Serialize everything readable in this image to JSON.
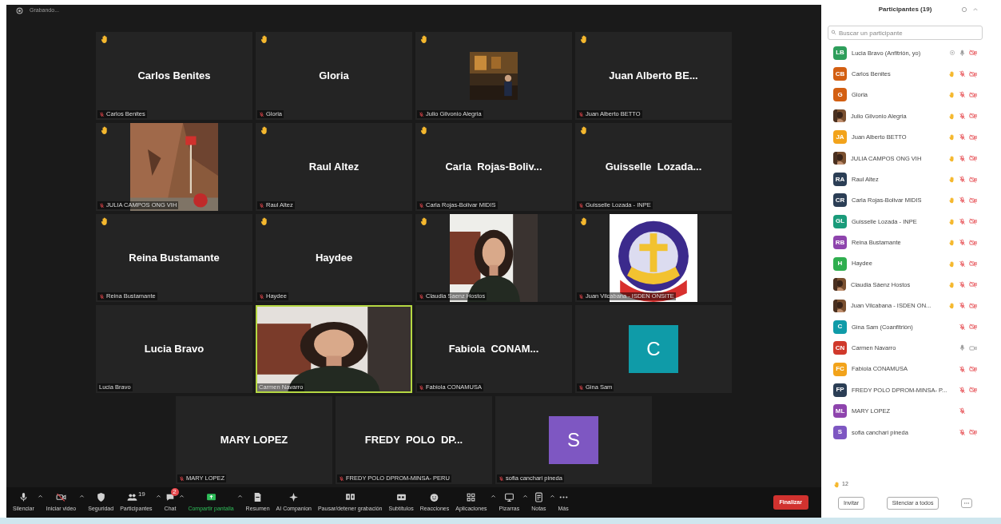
{
  "top_bar": {
    "status": "Grabando..."
  },
  "tiles": [
    {
      "kind": "name",
      "display": "Carlos Benites",
      "label": "Carlos Benites",
      "hand": true,
      "muted": true,
      "speaking": false
    },
    {
      "kind": "name",
      "display": "Gloria",
      "label": "Gloria",
      "hand": true,
      "muted": true,
      "speaking": false
    },
    {
      "kind": "picture",
      "label": "Julio Gilvonio Alegria",
      "hand": true,
      "muted": true,
      "speaking": false
    },
    {
      "kind": "name",
      "display": "Juan Alberto BE...",
      "label": "Juan Alberto BETTO",
      "hand": true,
      "muted": true,
      "speaking": false
    },
    {
      "kind": "picture",
      "label": "JULIA CAMPOS ONG VIH",
      "hand": true,
      "muted": true,
      "speaking": false
    },
    {
      "kind": "name",
      "display": "Raul Altez",
      "label": "Raul Altez",
      "hand": true,
      "muted": true,
      "speaking": false
    },
    {
      "kind": "name",
      "display": "Carla  Rojas-Boliv...",
      "label": "Carla Rojas-Bolivar MIDIS",
      "hand": true,
      "muted": true,
      "speaking": false
    },
    {
      "kind": "name",
      "display": "Guisselle  Lozada...",
      "label": "Guisselle Lozada - INPE",
      "hand": true,
      "muted": true,
      "speaking": false
    },
    {
      "kind": "name",
      "display": "Reina Bustamante",
      "label": "Reina Bustamante",
      "hand": true,
      "muted": true,
      "speaking": false
    },
    {
      "kind": "name",
      "display": "Haydee",
      "label": "Haydee",
      "hand": true,
      "muted": true,
      "speaking": false
    },
    {
      "kind": "picture",
      "label": "Claudia Saenz Hostos",
      "hand": true,
      "muted": true,
      "speaking": false
    },
    {
      "kind": "picture",
      "label": "Juan Vilcabana - ISDEN ONSITE",
      "hand": true,
      "muted": true,
      "speaking": false
    },
    {
      "kind": "name",
      "display": "Lucia Bravo",
      "label": "Lucia Bravo",
      "hand": false,
      "muted": false,
      "speaking": false
    },
    {
      "kind": "picture",
      "label": "Carmen Navarro",
      "hand": false,
      "muted": false,
      "speaking": true
    },
    {
      "kind": "name",
      "display": "Fabiola  CONAM...",
      "label": "Fabiola CONAMUSA",
      "hand": false,
      "muted": true,
      "speaking": false
    },
    {
      "kind": "avatar",
      "letter": "C",
      "color": "#0f9ba8",
      "label": "Gina Sam",
      "hand": false,
      "muted": true,
      "speaking": false
    },
    {
      "kind": "name",
      "display": "MARY LOPEZ",
      "label": "MARY LOPEZ",
      "hand": false,
      "muted": true,
      "speaking": false
    },
    {
      "kind": "name",
      "display": "FREDY  POLO  DP...",
      "label": "FREDY POLO DPROM-MINSA- PERU",
      "hand": false,
      "muted": true,
      "speaking": false
    },
    {
      "kind": "avatar",
      "letter": "S",
      "color": "#7e57c2",
      "label": "sofia canchari pineda",
      "hand": false,
      "muted": true,
      "speaking": false
    }
  ],
  "toolbar": [
    {
      "label": "Silenciar",
      "caret": true
    },
    {
      "label": "Iniciar video",
      "caret": true
    },
    {
      "label": "Seguridad",
      "caret": false
    },
    {
      "label": "Participantes",
      "count": "19",
      "caret": true
    },
    {
      "label": "Chat",
      "badge": "2",
      "caret": true
    },
    {
      "label": "Compartir pantalla",
      "caret": true
    },
    {
      "label": "Resumen",
      "caret": false
    },
    {
      "label": "AI Companion",
      "caret": false
    },
    {
      "label": "Pausar/detener grabación",
      "caret": false
    },
    {
      "label": "Subtítulos",
      "caret": false
    },
    {
      "label": "Reacciones",
      "caret": false
    },
    {
      "label": "Aplicaciones",
      "caret": true
    },
    {
      "label": "Pizarras",
      "caret": true
    },
    {
      "label": "Notas",
      "caret": true
    },
    {
      "label": "Más",
      "caret": false
    }
  ],
  "end_button": "Finalizar",
  "panel": {
    "title": "Participantes (19)",
    "search": {
      "placeholder": "Buscar un participante"
    },
    "participants": [
      {
        "name": "Lucia Bravo (Anfitrión, yo)",
        "avatar": "LB",
        "color": "#2e9e5b",
        "status_icon": true,
        "hand": false,
        "mic_muted": false,
        "video_off": true
      },
      {
        "name": "Carlos Benites",
        "avatar": "CB",
        "color": "#d35f12",
        "hand": true,
        "mic_muted": true,
        "video_off": true
      },
      {
        "name": "Gloria",
        "avatar": "G",
        "color": "#d35f12",
        "hand": true,
        "mic_muted": true,
        "video_off": true
      },
      {
        "name": "Julio Gilvonio Alegria",
        "kind": "picture",
        "hand": true,
        "mic_muted": true,
        "video_off": true
      },
      {
        "name": "Juan Alberto BETTO",
        "avatar": "JA",
        "color": "#f2a31b",
        "hand": true,
        "mic_muted": true,
        "video_off": true
      },
      {
        "name": "JULIA CAMPOS  ONG VIH",
        "kind": "picture",
        "hand": true,
        "mic_muted": true,
        "video_off": true
      },
      {
        "name": "Raul Altez",
        "avatar": "RA",
        "color": "#2b3e55",
        "hand": true,
        "mic_muted": true,
        "video_off": true
      },
      {
        "name": "Carla Rojas-Bolivar MIDIS",
        "avatar": "CR",
        "color": "#2b3e55",
        "hand": true,
        "mic_muted": true,
        "video_off": true
      },
      {
        "name": "Guisselle Lozada - INPE",
        "avatar": "GL",
        "color": "#1a9b7a",
        "hand": true,
        "mic_muted": true,
        "video_off": true
      },
      {
        "name": "Reina Bustamante",
        "avatar": "RB",
        "color": "#8e44ad",
        "hand": true,
        "mic_muted": true,
        "video_off": true
      },
      {
        "name": "Haydee",
        "avatar": "H",
        "color": "#2fae4f",
        "hand": true,
        "mic_muted": true,
        "video_off": true
      },
      {
        "name": "Claudia Sáenz Hostos",
        "kind": "picture",
        "hand": true,
        "mic_muted": true,
        "video_off": true
      },
      {
        "name": "Juan Vilcabana - ISDEN ON...",
        "kind": "picture",
        "hand": true,
        "mic_muted": true,
        "video_off": true
      },
      {
        "name": "Gina Sam (Coanfitrión)",
        "avatar": "C",
        "color": "#0f9ba8",
        "hand": false,
        "mic_muted": true,
        "video_off": true
      },
      {
        "name": "Carmen Navarro",
        "avatar": "CN",
        "color": "#d0392b",
        "hand": false,
        "mic_muted": false,
        "video_off": false
      },
      {
        "name": "Fabiola CONAMUSA",
        "avatar": "FC",
        "color": "#f2a31b",
        "hand": false,
        "mic_muted": true,
        "video_off": true
      },
      {
        "name": "FREDY POLO DPROM-MINSA- P...",
        "avatar": "FP",
        "color": "#2b3e55",
        "hand": false,
        "mic_muted": true,
        "video_off": true
      },
      {
        "name": "MARY LOPEZ",
        "avatar": "ML",
        "color": "#8e44ad",
        "hand": false,
        "mic_muted": true
      },
      {
        "name": "sofia canchari pineda",
        "avatar": "S",
        "color": "#7e57c2",
        "hand": false,
        "mic_muted": true,
        "video_off": true
      }
    ],
    "raised_count": "12",
    "buttons": [
      "Invitar",
      "Silenciar a todos"
    ]
  }
}
